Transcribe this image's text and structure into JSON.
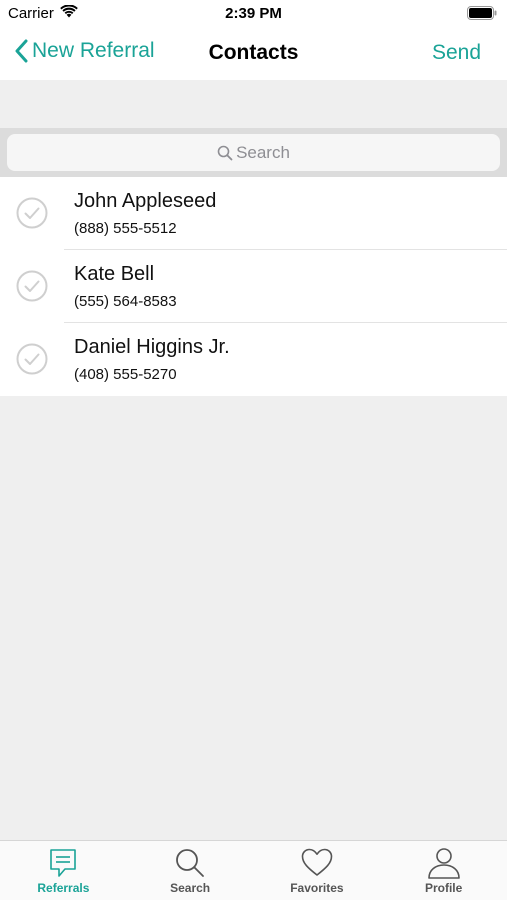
{
  "status_bar": {
    "carrier": "Carrier",
    "time": "2:39 PM"
  },
  "nav": {
    "back_label": "New Referral",
    "title": "Contacts",
    "send_label": "Send"
  },
  "search": {
    "placeholder": "Search"
  },
  "contacts": [
    {
      "name": "John Appleseed",
      "phone": "(888) 555-5512"
    },
    {
      "name": "Kate Bell",
      "phone": "(555) 564-8583"
    },
    {
      "name": "Daniel Higgins Jr.",
      "phone": "(408) 555-5270"
    }
  ],
  "tabs": [
    {
      "label": "Referrals",
      "icon": "chat-bubble-icon",
      "active": true
    },
    {
      "label": "Search",
      "icon": "magnifier-icon",
      "active": false
    },
    {
      "label": "Favorites",
      "icon": "heart-icon",
      "active": false
    },
    {
      "label": "Profile",
      "icon": "person-icon",
      "active": false
    }
  ],
  "colors": {
    "accent": "#1aa397",
    "background": "#efefef"
  }
}
